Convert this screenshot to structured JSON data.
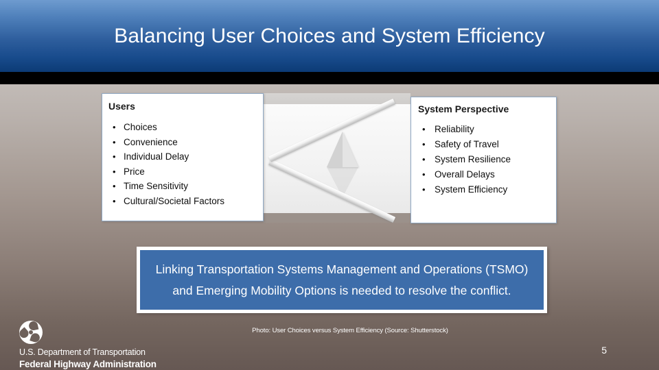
{
  "slide": {
    "title": "Balancing User Choices and System Efficiency",
    "number": "5"
  },
  "panels": {
    "users": {
      "title": "Users",
      "bullet_glyph": "•",
      "items": [
        "Choices",
        "Convenience",
        "Individual Delay",
        "Price",
        "Time Sensitivity",
        "Cultural/Societal Factors"
      ]
    },
    "system": {
      "title": "System Perspective",
      "bullet_glyph": "•",
      "items": [
        "Reliability",
        "Safety of Travel",
        "System Resilience",
        "Overall Delays",
        "System Efficiency"
      ]
    }
  },
  "photo": {
    "name": "seesaw-balance-photo",
    "credit": "Photo: User Choices versus System Efficiency (Source: Shutterstock)"
  },
  "callout": {
    "text": "Linking Transportation Systems Management and Operations (TSMO) and Emerging Mobility Options is needed to resolve the conflict."
  },
  "footer": {
    "agency_line1": "U.S. Department of Transportation",
    "agency_line2": "Federal Highway Administration",
    "seal_icon": "dot-triskelion-icon"
  },
  "colors": {
    "header_blue_top": "#6e9bcf",
    "header_blue_bottom": "#0c3b75",
    "callout_blue": "#3d6daa",
    "panel_border": "#8fa8c4",
    "background_top": "#d3d0ce",
    "background_bottom": "#665853",
    "text_white": "#ffffff",
    "text_dark": "#0d0d0d"
  }
}
